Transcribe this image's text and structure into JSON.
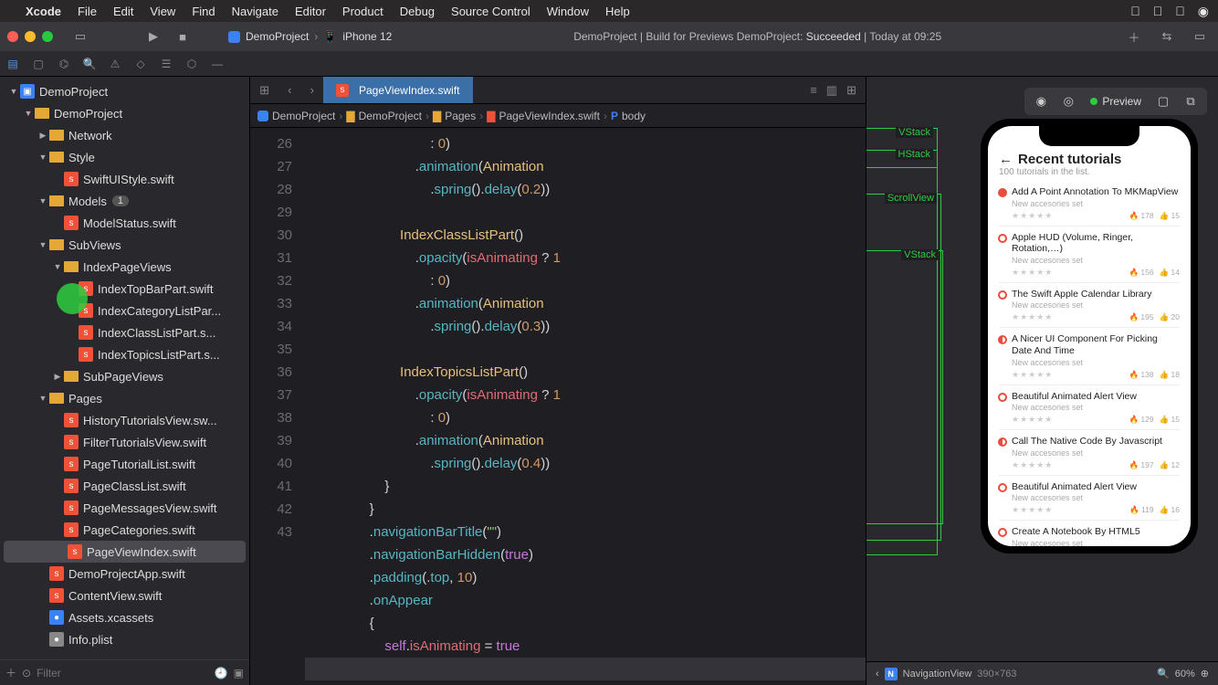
{
  "menubar": {
    "app": "Xcode",
    "items": [
      "File",
      "Edit",
      "View",
      "Find",
      "Navigate",
      "Editor",
      "Product",
      "Debug",
      "Source Control",
      "Window",
      "Help"
    ]
  },
  "scheme": {
    "project": "DemoProject",
    "device": "iPhone 12"
  },
  "buildStatus": {
    "prefix": "DemoProject | Build for Previews DemoProject: ",
    "result": "Succeeded",
    "time": "Today at 09:25"
  },
  "navIcons": [
    "folder",
    "square",
    "tree",
    "search",
    "warn",
    "tag",
    "chat",
    "box",
    "minus"
  ],
  "tree": [
    {
      "d": 0,
      "t": "proj",
      "n": "DemoProject",
      "o": 1
    },
    {
      "d": 1,
      "t": "fold",
      "n": "DemoProject",
      "o": 1
    },
    {
      "d": 2,
      "t": "fold",
      "n": "Network",
      "o": 0,
      "c": 1
    },
    {
      "d": 2,
      "t": "fold",
      "n": "Style",
      "o": 1
    },
    {
      "d": 3,
      "t": "swift",
      "n": "SwiftUIStyle.swift"
    },
    {
      "d": 2,
      "t": "fold",
      "n": "Models",
      "o": 1,
      "badge": "1"
    },
    {
      "d": 3,
      "t": "swift",
      "n": "ModelStatus.swift"
    },
    {
      "d": 2,
      "t": "fold",
      "n": "SubViews",
      "o": 1
    },
    {
      "d": 3,
      "t": "fold",
      "n": "IndexPageViews",
      "o": 1
    },
    {
      "d": 4,
      "t": "swift",
      "n": "IndexTopBarPart.swift"
    },
    {
      "d": 4,
      "t": "swift",
      "n": "IndexCategoryListPar..."
    },
    {
      "d": 4,
      "t": "swift",
      "n": "IndexClassListPart.s..."
    },
    {
      "d": 4,
      "t": "swift",
      "n": "IndexTopicsListPart.s..."
    },
    {
      "d": 3,
      "t": "fold",
      "n": "SubPageViews",
      "o": 0,
      "c": 1
    },
    {
      "d": 2,
      "t": "fold",
      "n": "Pages",
      "o": 1
    },
    {
      "d": 3,
      "t": "swift",
      "n": "HistoryTutorialsView.sw..."
    },
    {
      "d": 3,
      "t": "swift",
      "n": "FilterTutorialsView.swift"
    },
    {
      "d": 3,
      "t": "swift",
      "n": "PageTutorialList.swift"
    },
    {
      "d": 3,
      "t": "swift",
      "n": "PageClassList.swift"
    },
    {
      "d": 3,
      "t": "swift",
      "n": "PageMessagesView.swift"
    },
    {
      "d": 3,
      "t": "swift",
      "n": "PageCategories.swift"
    },
    {
      "d": 3,
      "t": "swift",
      "n": "PageViewIndex.swift",
      "sel": 1
    },
    {
      "d": 2,
      "t": "swift",
      "n": "DemoProjectApp.swift"
    },
    {
      "d": 2,
      "t": "swift",
      "n": "ContentView.swift"
    },
    {
      "d": 2,
      "t": "asset",
      "n": "Assets.xcassets"
    },
    {
      "d": 2,
      "t": "plist",
      "n": "Info.plist"
    }
  ],
  "filter": {
    "placeholder": "Filter"
  },
  "tab": {
    "file": "PageViewIndex.swift"
  },
  "jumpbar": [
    "DemoProject",
    "DemoProject",
    "Pages",
    "PageViewIndex.swift",
    "body"
  ],
  "code": {
    "startLine": 26,
    "highlight": 43,
    "lines": [
      "                                : 0)",
      "                            .animation(Animation",
      "                                .spring().delay(0.2))",
      "",
      "                        IndexClassListPart()",
      "                            .opacity(isAnimating ? 1",
      "                                : 0)",
      "                            .animation(Animation",
      "                                .spring().delay(0.3))",
      "",
      "                        IndexTopicsListPart()",
      "                            .opacity(isAnimating ? 1",
      "                                : 0)",
      "                            .animation(Animation",
      "                                .spring().delay(0.4))",
      "                    }",
      "                }",
      "                .navigationBarTitle(\"\")",
      "                .navigationBarHidden(true)",
      "                .padding(.top, 10)",
      "                .onAppear",
      "                {",
      "                    self.isAnimating = true",
      "                }"
    ]
  },
  "overlays": [
    "VStack",
    "HStack",
    "ScrollView",
    "VStack"
  ],
  "preview": {
    "label": "Preview",
    "header": {
      "title": "Recent tutorials",
      "subtitle": "100 tutorials in the list."
    },
    "rows": [
      {
        "dot": "f",
        "t": "Add A Point Annotation To MKMapView",
        "s": "New accesories set",
        "v": "178",
        "l": "15"
      },
      {
        "dot": "",
        "t": "Apple HUD (Volume, Ringer, Rotation,…)",
        "s": "New accesories set",
        "v": "156",
        "l": "14"
      },
      {
        "dot": "",
        "t": "The Swift Apple Calendar Library",
        "s": "New accesories set",
        "v": "195",
        "l": "20"
      },
      {
        "dot": "h",
        "t": "A Nicer UI Component For Picking Date And Time",
        "s": "New accesories set",
        "v": "138",
        "l": "18"
      },
      {
        "dot": "",
        "t": "Beautiful Animated Alert View",
        "s": "New accesories set",
        "v": "129",
        "l": "15"
      },
      {
        "dot": "h",
        "t": "Call The Native Code By Javascript",
        "s": "New accesories set",
        "v": "197",
        "l": "12"
      },
      {
        "dot": "",
        "t": "Beautiful Animated Alert View",
        "s": "New accesories set",
        "v": "119",
        "l": "16"
      },
      {
        "dot": "",
        "t": "Create A Notebook By HTML5",
        "s": "New accesories set",
        "v": "",
        "l": ""
      }
    ]
  },
  "statusbar": {
    "view": "NavigationView",
    "size": "390×763",
    "zoom": "60%"
  }
}
